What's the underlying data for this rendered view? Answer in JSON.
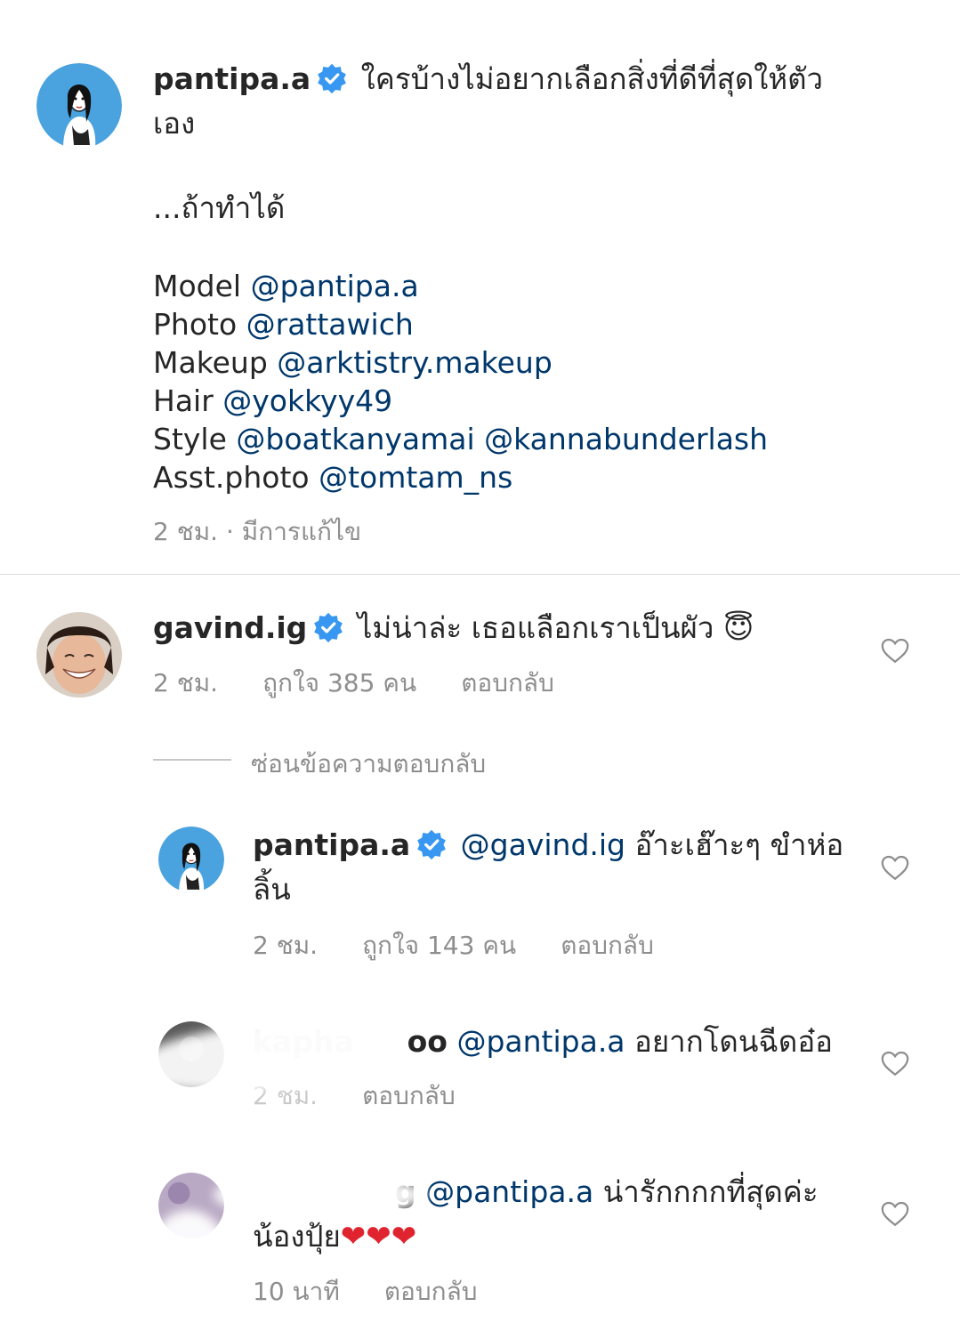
{
  "post": {
    "username": "pantipa.a",
    "caption_line1": "ใครบ้างไม่อยากเลือกสิ่งที่ดีที่สุดให้ตัว",
    "caption_line2": "เอง",
    "caption_line3": "...ถ้าทำได้",
    "credits": [
      {
        "label": "Model",
        "handles": "@pantipa.a"
      },
      {
        "label": "Photo",
        "handles": "@rattawich"
      },
      {
        "label": "Makeup",
        "handles": "@arktistry.makeup"
      },
      {
        "label": "Hair",
        "handles": "@yokkyy49"
      },
      {
        "label": "Style",
        "handles": "@boatkanyamai @kannabunderlash"
      },
      {
        "label": "Asst.photo",
        "handles": "@tomtam_ns"
      }
    ],
    "meta": "2 ชม. · มีการแก้ไข"
  },
  "comment1": {
    "username": "gavind.ig",
    "text": "ไม่น่าล่ะ เธอแลือกเราเป็นผัว",
    "emoji": "😇",
    "time": "2 ชม.",
    "likes": "ถูกใจ 385 คน",
    "reply": "ตอบกลับ"
  },
  "hide_replies": "ซ่อนข้อความตอบกลับ",
  "reply1": {
    "username": "pantipa.a",
    "mention": "@gavind.ig",
    "text": "อ๊าะเฮ๊าะๆ ขำห่อ",
    "text2": "ลิ้น",
    "time": "2 ชม.",
    "likes": "ถูกใจ 143 คน",
    "reply": "ตอบกลับ"
  },
  "reply2": {
    "username_partial": "kapha",
    "username_tail": "oo",
    "mention": "@pantipa.a",
    "text": "อยากโดนฉีดอ๋อ",
    "time": "2 ชม.",
    "reply": "ตอบกลับ"
  },
  "reply3": {
    "username_tail": "g",
    "mention": "@pantipa.a",
    "text": "น่ารักกกกที่สุดค่ะ",
    "text2": "น้องปุ้ย",
    "hearts": "❤❤❤",
    "time": "10 นาที",
    "reply": "ตอบกลับ"
  },
  "colors": {
    "link": "#00376b",
    "meta": "#8e8e8e",
    "verified": "#3897f0",
    "avatar_bg": "#4aa3df"
  },
  "icons": [
    "verified-badge-icon",
    "heart-outline-icon"
  ]
}
